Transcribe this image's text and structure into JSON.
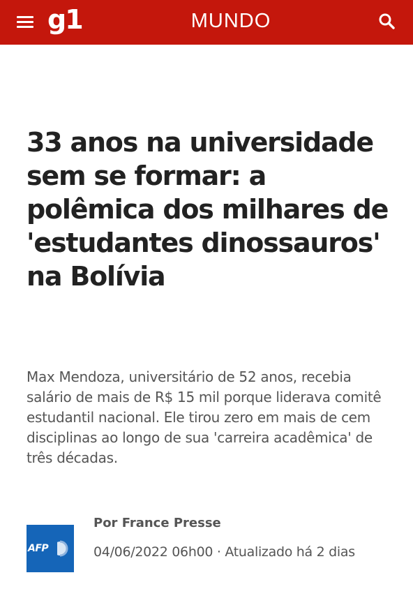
{
  "header": {
    "menu_icon": "hamburger-menu-icon",
    "logo": "g1",
    "section": "MUNDO",
    "search_icon": "search-icon",
    "background_color": "#c4170c"
  },
  "article": {
    "headline": "33 anos na universidade sem se formar: a polêmica dos milhares de 'estudantes dinossauros' na Bolívia",
    "subtitle": "Max Mendoza, universitário de 52 anos, recebia salário de mais de R$ 15 mil porque liderava comitê estudantil nacional. Ele tirou zero em mais de cem disciplinas ao longo de sua 'carreira acadêmica' de três décadas."
  },
  "byline": {
    "agency_logo": "AFP",
    "agency_logo_color": "#1565b8",
    "author": "Por France Presse",
    "date": "04/06/2022 06h00",
    "separator": " · ",
    "updated": "Atualizado há 2 dias"
  }
}
